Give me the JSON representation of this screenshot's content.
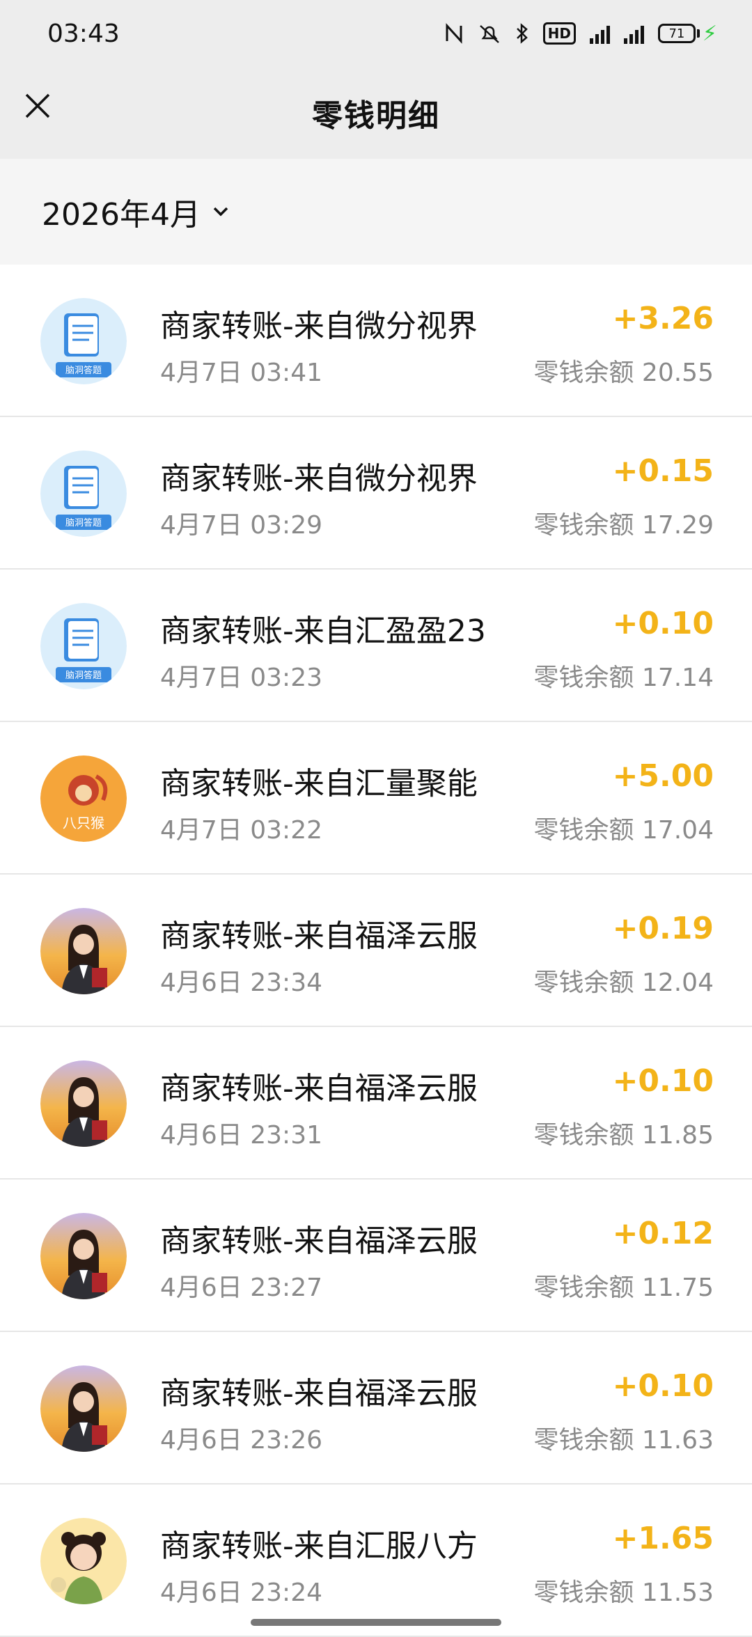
{
  "status_bar": {
    "time": "03:43",
    "icons": [
      "nfc-icon",
      "mute-icon",
      "bluetooth-icon",
      "hd-icon",
      "signal-4g-icon",
      "signal-4g-icon"
    ],
    "hd_label": "HD",
    "battery": "71"
  },
  "header": {
    "title": "零钱明细"
  },
  "filter": {
    "month": "2026年4月"
  },
  "colors": {
    "amount": "#f3b318",
    "secondary_text": "#8a8a8a"
  },
  "transactions": [
    {
      "title": "商家转账-来自微分视界",
      "time": "4月7日 03:41",
      "amount": "+3.26",
      "balance": "零钱余额 20.55",
      "avatar": "quiz-book-avatar"
    },
    {
      "title": "商家转账-来自微分视界",
      "time": "4月7日 03:29",
      "amount": "+0.15",
      "balance": "零钱余额 17.29",
      "avatar": "quiz-book-avatar"
    },
    {
      "title": "商家转账-来自汇盈盈23",
      "time": "4月7日 03:23",
      "amount": "+0.10",
      "balance": "零钱余额 17.14",
      "avatar": "quiz-book-avatar"
    },
    {
      "title": "商家转账-来自汇量聚能",
      "time": "4月7日 03:22",
      "amount": "+5.00",
      "balance": "零钱余额 17.04",
      "avatar": "monkey-avatar"
    },
    {
      "title": "商家转账-来自福泽云服",
      "time": "4月6日 23:34",
      "amount": "+0.19",
      "balance": "零钱余额 12.04",
      "avatar": "woman-avatar"
    },
    {
      "title": "商家转账-来自福泽云服",
      "time": "4月6日 23:31",
      "amount": "+0.10",
      "balance": "零钱余额 11.85",
      "avatar": "woman-avatar"
    },
    {
      "title": "商家转账-来自福泽云服",
      "time": "4月6日 23:27",
      "amount": "+0.12",
      "balance": "零钱余额 11.75",
      "avatar": "woman-avatar"
    },
    {
      "title": "商家转账-来自福泽云服",
      "time": "4月6日 23:26",
      "amount": "+0.10",
      "balance": "零钱余额 11.63",
      "avatar": "woman-avatar"
    },
    {
      "title": "商家转账-来自汇服八方",
      "time": "4月6日 23:24",
      "amount": "+1.65",
      "balance": "零钱余额 11.53",
      "avatar": "girl-avatar"
    }
  ],
  "avatar_labels": {
    "quiz": "脑洞答题",
    "monkey": "八只猴"
  }
}
